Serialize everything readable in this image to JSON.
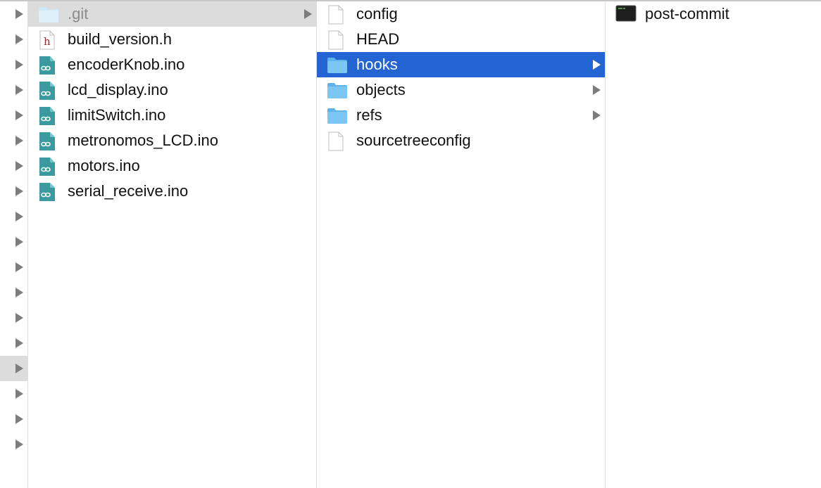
{
  "parent_column": {
    "row_count": 18,
    "highlighted_row": 14
  },
  "columns": [
    {
      "items": [
        {
          "label": ".git",
          "icon": "folder-icon",
          "has_children": true,
          "state": "selected-inactive"
        },
        {
          "label": "build_version.h",
          "icon": "header-file-icon",
          "has_children": false
        },
        {
          "label": "encoderKnob.ino",
          "icon": "arduino-file-icon",
          "has_children": false
        },
        {
          "label": "lcd_display.ino",
          "icon": "arduino-file-icon",
          "has_children": false
        },
        {
          "label": "limitSwitch.ino",
          "icon": "arduino-file-icon",
          "has_children": false
        },
        {
          "label": "metronomos_LCD.ino",
          "icon": "arduino-file-icon",
          "has_children": false
        },
        {
          "label": "motors.ino",
          "icon": "arduino-file-icon",
          "has_children": false
        },
        {
          "label": "serial_receive.ino",
          "icon": "arduino-file-icon",
          "has_children": false
        }
      ]
    },
    {
      "items": [
        {
          "label": "config",
          "icon": "document-icon",
          "has_children": false
        },
        {
          "label": "HEAD",
          "icon": "document-icon",
          "has_children": false
        },
        {
          "label": "hooks",
          "icon": "folder-icon",
          "has_children": true,
          "state": "selected-active"
        },
        {
          "label": "objects",
          "icon": "folder-icon",
          "has_children": true
        },
        {
          "label": "refs",
          "icon": "folder-icon",
          "has_children": true
        },
        {
          "label": "sourcetreeconfig",
          "icon": "document-icon",
          "has_children": false
        }
      ]
    },
    {
      "items": [
        {
          "label": "post-commit",
          "icon": "terminal-executable-icon",
          "has_children": false
        }
      ]
    }
  ],
  "colors": {
    "selection_active": "#2464d2",
    "selection_inactive": "#dcdcdc",
    "arduino_teal": "#3a9aa0",
    "folder_blue": "#74c2f2"
  }
}
